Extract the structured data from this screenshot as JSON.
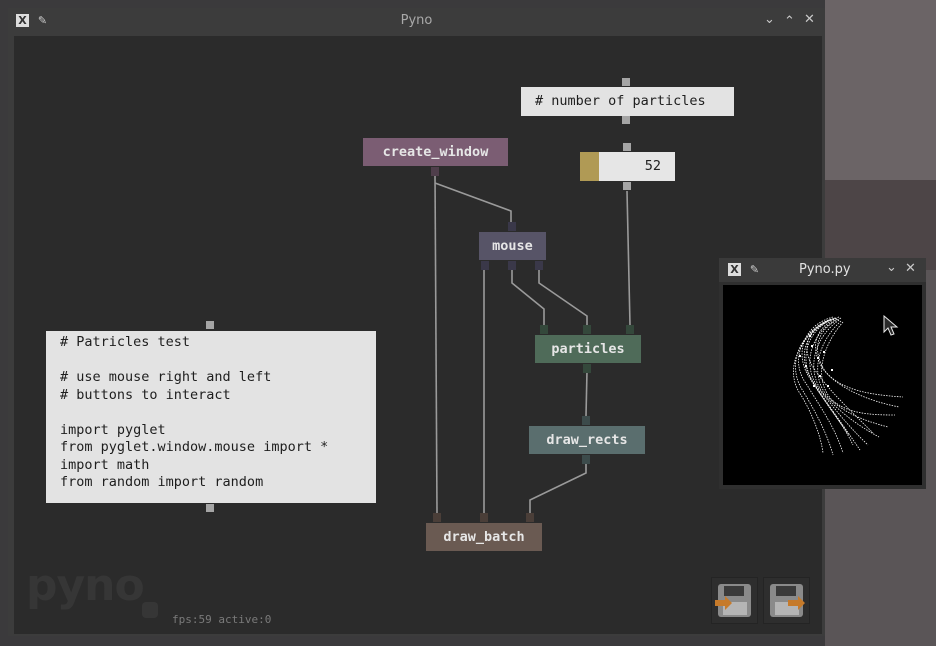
{
  "main_window": {
    "title": "Pyno",
    "status": "fps:59 active:0",
    "logo": "pyno"
  },
  "nodes": {
    "create_window": "create_window",
    "mouse": "mouse",
    "particles": "particles",
    "draw_rects": "draw_rects",
    "draw_batch": "draw_batch"
  },
  "comments": {
    "particles_label": "# number of particles",
    "code": "# Patricles test\n\n# use mouse right and left\n# buttons to interact\n\nimport pyglet\nfrom pyglet.window.mouse import *\nimport math\nfrom random import random"
  },
  "number_field": {
    "value": "52"
  },
  "colors": {
    "create_window": "#7b5d73",
    "mouse": "#575467",
    "particles": "#4f6b59",
    "draw_rects": "#5a6e6e",
    "draw_batch": "#6a5a52",
    "number_accent": "#b09a55"
  },
  "output_window": {
    "title": "Pyno.py"
  },
  "icons": {
    "app": "x-app-icon",
    "pin": "pin-icon",
    "minimize": "chevron-down-icon",
    "maximize": "chevron-up-icon",
    "close": "close-icon",
    "load": "load-floppy-icon",
    "save": "save-floppy-icon"
  }
}
